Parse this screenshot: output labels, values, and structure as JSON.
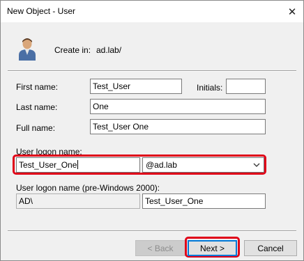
{
  "window": {
    "title": "New Object - User"
  },
  "header": {
    "create_in_label": "Create in:",
    "create_in_value": "ad.lab/"
  },
  "form": {
    "first_name_label": "First name:",
    "first_name_value": "Test_User",
    "initials_label": "Initials:",
    "initials_value": "",
    "last_name_label": "Last name:",
    "last_name_value": "One",
    "full_name_label": "Full name:",
    "full_name_value": "Test_User One",
    "logon_name_label": "User logon name:",
    "logon_name_value": "Test_User_One",
    "domain_suffix_value": "@ad.lab",
    "pre2000_label": "User logon name (pre-Windows 2000):",
    "pre2000_domain_value": "AD\\",
    "pre2000_name_value": "Test_User_One"
  },
  "buttons": {
    "back": "< Back",
    "next": "Next >",
    "cancel": "Cancel"
  },
  "colors": {
    "highlight": "#e00018",
    "default_button_border": "#0078d7"
  },
  "icons": {
    "header": "user-avatar-icon",
    "close": "close-icon",
    "dropdown": "chevron-down-icon"
  }
}
